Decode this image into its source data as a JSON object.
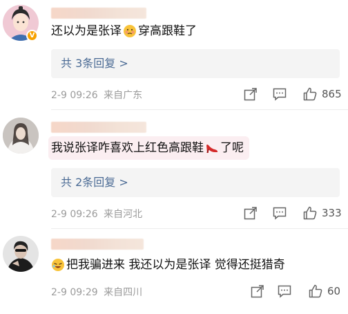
{
  "comments": [
    {
      "text_before": "还以为是张译",
      "emoji": "flushed-face-emoji",
      "text_after": "穿高跟鞋了",
      "replies_label": "共 3条回复 >",
      "date": "2-9 09:26",
      "location": "来自广东",
      "likes": "865",
      "verified_badge": "V"
    },
    {
      "text_before": "我说张译咋喜欢上红色高跟鞋",
      "emoji": "high-heel-emoji",
      "text_after": "了呢",
      "replies_label": "共 2条回复 >",
      "date": "2-9 09:26",
      "location": "来自河北",
      "likes": "333"
    },
    {
      "emoji": "laughing-face-emoji",
      "text_after": "把我骗进来 我还以为是张译 觉得还挺猎奇",
      "date": "2-9 09:29",
      "location": "来自四川",
      "likes": "60"
    }
  ],
  "colors": {
    "link": "#4a6a94",
    "meta": "#9a9a9a",
    "highlight_bg": "#fbeef1",
    "badge": "#f7a100"
  }
}
